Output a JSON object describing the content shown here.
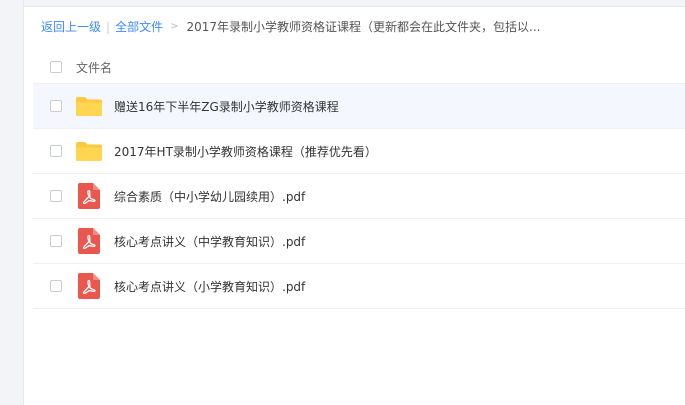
{
  "breadcrumb": {
    "back": "返回上一级",
    "all_files": "全部文件",
    "current": "2017年录制小学教师资格证课程（更新都会在此文件夹，包括以..."
  },
  "header": {
    "name_label": "文件名"
  },
  "files": [
    {
      "name": "赠送16年下半年ZG录制小学教师资格课程",
      "type": "folder",
      "icon": "folder-icon"
    },
    {
      "name": "2017年HT录制小学教师资格课程（推荐优先看）",
      "type": "folder",
      "icon": "folder-icon"
    },
    {
      "name": "综合素质（中小学幼儿园续用）.pdf",
      "type": "pdf",
      "icon": "pdf-icon"
    },
    {
      "name": "核心考点讲义（中学教育知识）.pdf",
      "type": "pdf",
      "icon": "pdf-icon"
    },
    {
      "name": "核心考点讲义（小学教育知识）.pdf",
      "type": "pdf",
      "icon": "pdf-icon"
    }
  ],
  "colors": {
    "link": "#3b8cff",
    "folder": "#ffc93d",
    "pdf": "#e9574f",
    "row_hover": "#f4f7fd"
  }
}
